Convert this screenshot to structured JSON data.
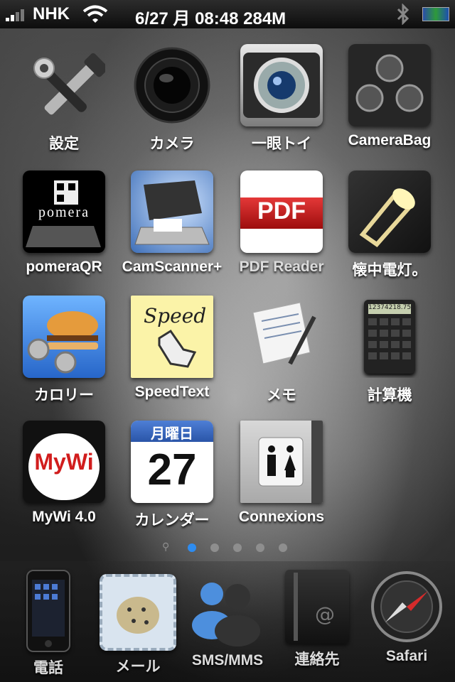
{
  "status_bar": {
    "carrier": "NHK",
    "date": "6/27 月",
    "time": "08:48",
    "memory": "284M"
  },
  "apps": [
    {
      "label": "設定",
      "icon": "settings-wrench-hammer-icon"
    },
    {
      "label": "カメラ",
      "icon": "camera-lens-icon"
    },
    {
      "label": "一眼トイ",
      "icon": "toy-camera-lens-icon"
    },
    {
      "label": "CameraBag",
      "icon": "camerabag-icon"
    },
    {
      "label": "pomeraQR",
      "icon": "pomera-qr-icon"
    },
    {
      "label": "CamScanner+",
      "icon": "scanner-icon"
    },
    {
      "label": "PDF Reader",
      "icon": "pdf-icon"
    },
    {
      "label": "懐中電灯。",
      "icon": "flashlight-icon"
    },
    {
      "label": "カロリー",
      "icon": "burger-dumbbell-icon"
    },
    {
      "label": "SpeedText",
      "icon": "speedtext-icon"
    },
    {
      "label": "メモ",
      "icon": "notes-pen-icon"
    },
    {
      "label": "計算機",
      "icon": "calculator-icon"
    },
    {
      "label": "MyWi 4.0",
      "icon": "mywi-icon"
    },
    {
      "label": "カレンダー",
      "icon": "calendar-icon"
    },
    {
      "label": "Connexions",
      "icon": "contacts-book-icon"
    }
  ],
  "icon_text": {
    "pomera": "pomera",
    "pdf": "PDF",
    "speed": "Speed",
    "mywi": "MyWi",
    "calendar_weekday": "月曜日",
    "calendar_day": "27",
    "calculator_display": "12374218.75"
  },
  "page_indicator": {
    "pages": 5,
    "current": 1
  },
  "dock": [
    {
      "label": "電話",
      "icon": "phone-icon"
    },
    {
      "label": "メール",
      "icon": "mail-stamp-icon"
    },
    {
      "label": "SMS/MMS",
      "icon": "messenger-icon"
    },
    {
      "label": "連絡先",
      "icon": "address-book-icon"
    },
    {
      "label": "Safari",
      "icon": "compass-icon"
    }
  ],
  "colors": {
    "page_dot_active": "#2e8cf0",
    "page_dot": "#8e8e8e"
  }
}
